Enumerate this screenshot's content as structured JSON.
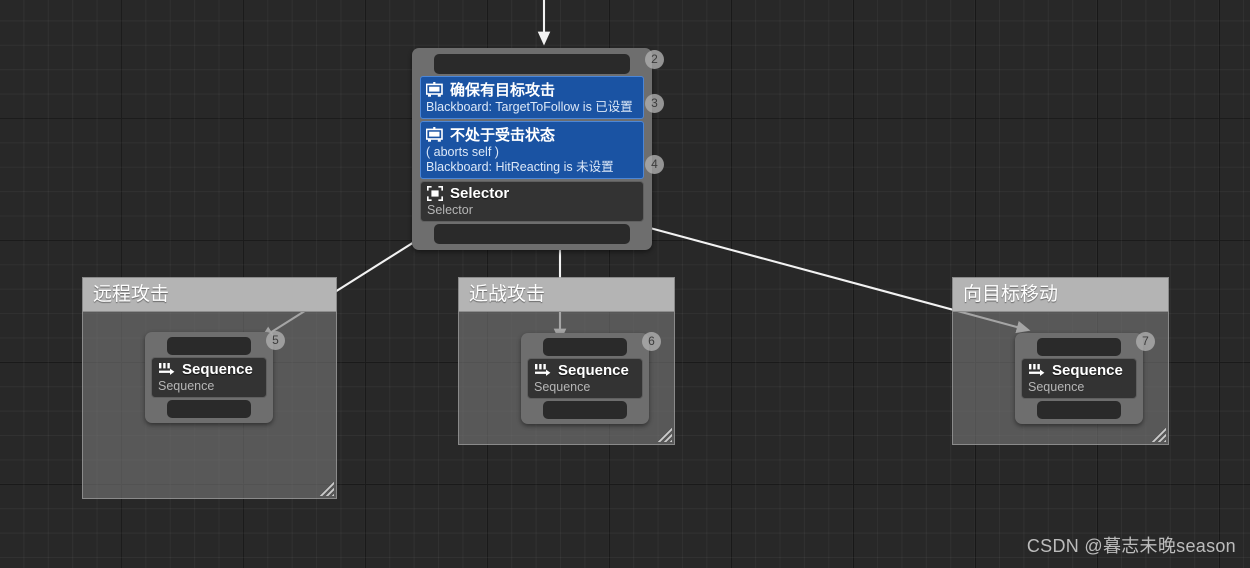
{
  "editor": {
    "kind": "behavior-tree-graph",
    "background_color": "#282828",
    "grid_line_color": "#383838",
    "grid_major_color": "#1a1a1a"
  },
  "root_node": {
    "decorators": [
      {
        "icon": "blackboard-icon",
        "title": "确保有目标攻击",
        "lines": [
          "Blackboard: TargetToFollow is 已设置"
        ],
        "badge": "3",
        "color": "#1a53a3"
      },
      {
        "icon": "blackboard-icon",
        "title": "不处于受击状态",
        "lines": [
          "( aborts self )",
          "Blackboard: HitReacting is 未设置"
        ],
        "badge": "4",
        "color": "#1a53a3"
      }
    ],
    "main": {
      "icon": "selector-icon",
      "title": "Selector",
      "subtitle": "Selector",
      "badge": "2"
    }
  },
  "comments": [
    {
      "title": "远程攻击",
      "node": {
        "icon": "sequence-icon",
        "title": "Sequence",
        "subtitle": "Sequence",
        "badge": "5"
      },
      "resize_handle": "resize-grip-icon"
    },
    {
      "title": "近战攻击",
      "node": {
        "icon": "sequence-icon",
        "title": "Sequence",
        "subtitle": "Sequence",
        "badge": "6"
      },
      "resize_handle": "resize-grip-icon"
    },
    {
      "title": "向目标移动",
      "node": {
        "icon": "sequence-icon",
        "title": "Sequence",
        "subtitle": "Sequence",
        "badge": "7"
      },
      "resize_handle": "resize-grip-icon"
    }
  ],
  "watermark": {
    "text": "CSDN @暮志未晚season"
  }
}
